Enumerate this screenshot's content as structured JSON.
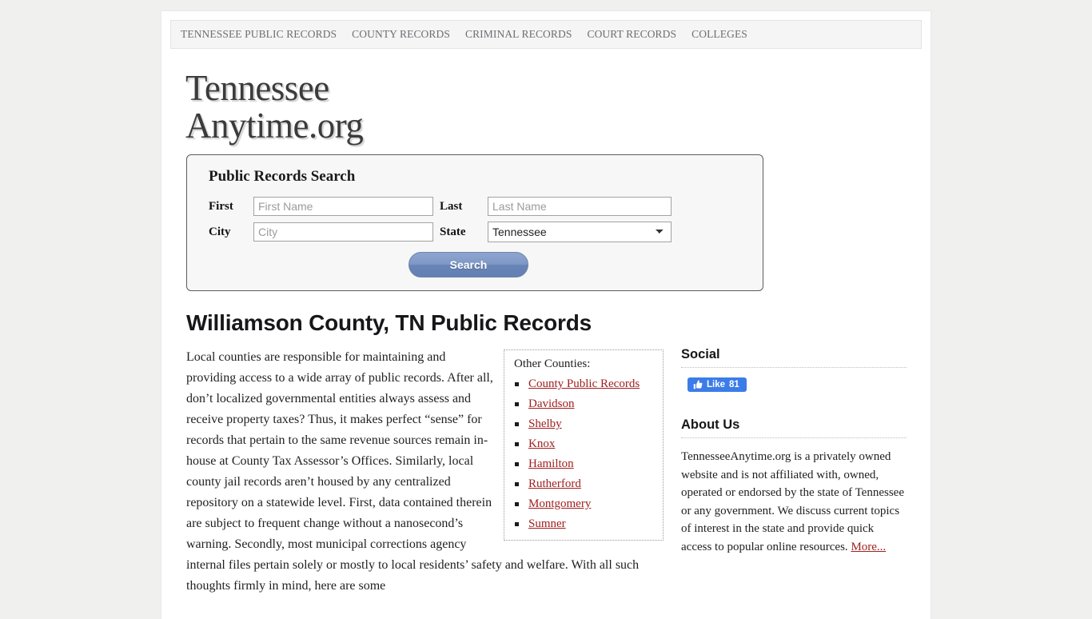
{
  "nav": {
    "items": [
      {
        "label": "TENNESSEE PUBLIC RECORDS"
      },
      {
        "label": "COUNTY RECORDS"
      },
      {
        "label": "CRIMINAL RECORDS"
      },
      {
        "label": "COURT RECORDS"
      },
      {
        "label": "COLLEGES"
      }
    ]
  },
  "logo": {
    "line1": "Tennessee",
    "line2": "Anytime.org"
  },
  "search": {
    "title": "Public Records Search",
    "first_label": "First",
    "first_placeholder": "First Name",
    "first_value": "",
    "last_label": "Last",
    "last_placeholder": "Last Name",
    "last_value": "",
    "city_label": "City",
    "city_placeholder": "City",
    "city_value": "",
    "state_label": "State",
    "state_selected": "Tennessee",
    "button_label": "Search"
  },
  "main": {
    "title": "Williamson County, TN Public Records",
    "paragraph": "Local counties are responsible for maintaining and providing access to a wide array of public records. After all, don’t localized governmental entities always assess and receive property taxes? Thus, it makes perfect “sense” for records that pertain to the same revenue sources remain in-house at County Tax Assessor’s Offices. Similarly, local county jail records aren’t housed by any centralized repository on a statewide level. First, data contained therein are subject to frequent change without a nanosecond’s warning. Secondly, most municipal corrections agency internal files pertain solely or mostly to local residents’ safety and welfare. With all such thoughts firmly in mind, here are some"
  },
  "counties": {
    "title": "Other Counties:",
    "items": [
      {
        "label": "County Public Records"
      },
      {
        "label": "Davidson"
      },
      {
        "label": "Shelby"
      },
      {
        "label": "Knox"
      },
      {
        "label": "Hamilton"
      },
      {
        "label": "Rutherford"
      },
      {
        "label": "Montgomery"
      },
      {
        "label": "Sumner"
      }
    ]
  },
  "sidebar": {
    "social_heading": "Social",
    "like_label": "Like",
    "like_count": "81",
    "about_heading": "About Us",
    "about_text": "TennesseeAnytime.org is a privately owned website and is not affiliated with, owned, operated or endorsed by the state of Tennessee or any government. We discuss current topics of interest in the state and provide quick access to popular online resources. ",
    "about_more": "More..."
  },
  "colors": {
    "link_red": "#a02020",
    "button_blue": "#7e98c6",
    "facebook_blue": "#3b7ce8",
    "page_bg": "#f0f0ef"
  }
}
